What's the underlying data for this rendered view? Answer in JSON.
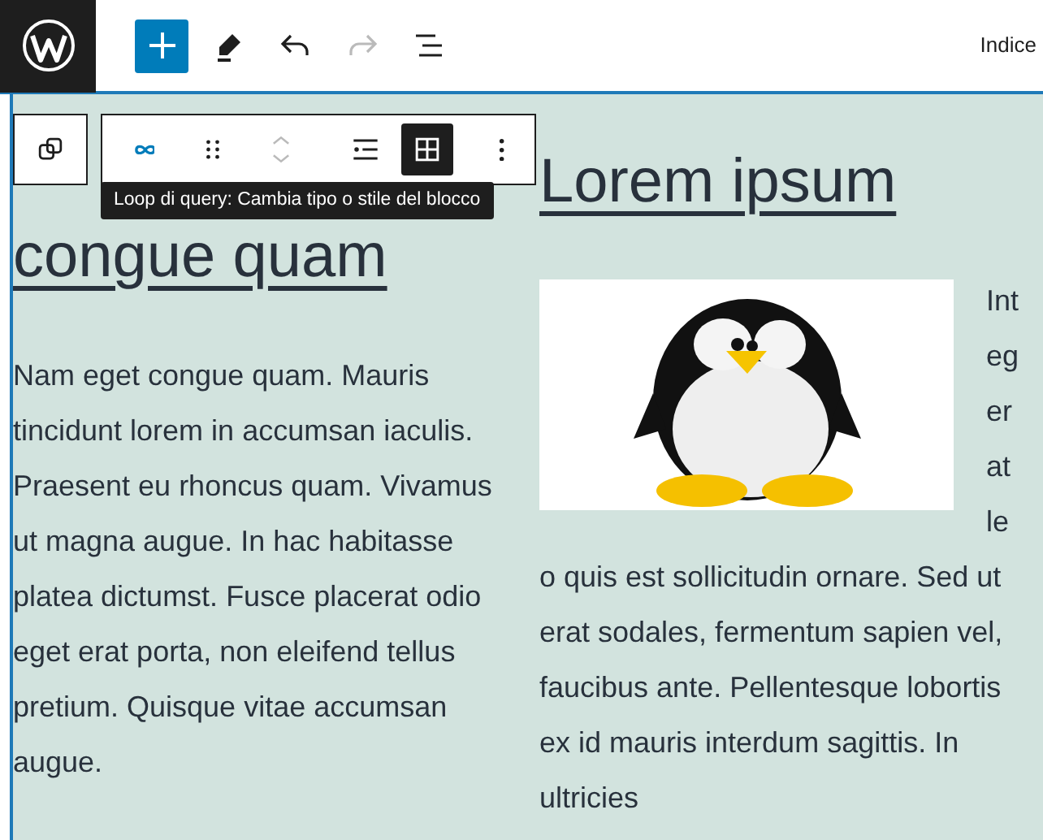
{
  "top_bar": {
    "tools": [
      {
        "kind": "add",
        "disabled": false
      },
      {
        "kind": "pen",
        "disabled": false
      },
      {
        "kind": "undo",
        "disabled": false
      },
      {
        "kind": "redo",
        "disabled": true
      },
      {
        "kind": "list",
        "disabled": false
      }
    ],
    "right_label": "Indice"
  },
  "block_toolbar": {
    "groups": [
      {
        "items": [
          {
            "kind": "duplicate",
            "selected": false,
            "disabled": false
          }
        ]
      },
      {
        "items": [
          {
            "kind": "loop",
            "selected": false,
            "disabled": false
          },
          {
            "kind": "drag",
            "selected": false,
            "disabled": false
          },
          {
            "kind": "move",
            "selected": false,
            "disabled": true
          }
        ]
      },
      {
        "items": [
          {
            "kind": "justify",
            "selected": false,
            "disabled": false
          },
          {
            "kind": "grid",
            "selected": true,
            "disabled": false
          }
        ]
      },
      {
        "items": [
          {
            "kind": "more",
            "selected": false,
            "disabled": false
          }
        ]
      }
    ],
    "tooltip": "Loop di query: Cambia tipo o stile del blocco"
  },
  "columns": [
    {
      "kind": "text",
      "title": "congue quam",
      "paragraph": "Nam eget congue quam. Mauris tincidunt lorem in accumsan iaculis. Praesent eu rhoncus quam. Vivamus ut magna augue. In hac habitasse platea dictumst. Fusce placerat odio eget erat porta, non eleifend tellus pretium. Quisque vitae accumsan augue."
    },
    {
      "kind": "image_text",
      "title": "Lorem ipsum",
      "side_text": "Integer at le",
      "paragraph": "o quis est sollicitudin ornare. Sed ut erat sodales, fermentum sapien vel, faucibus ante. Pellentesque lobortis ex id mauris interdum sagittis. In ultricies"
    }
  ]
}
